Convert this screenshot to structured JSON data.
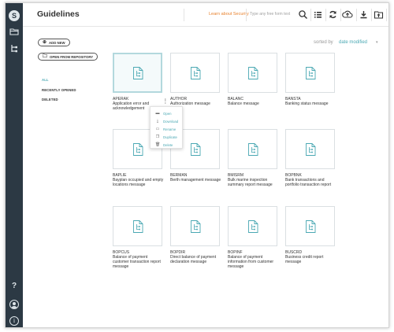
{
  "app": {
    "logo_letter": "S"
  },
  "header": {
    "title": "Guidelines",
    "learn_link": "Learn about Security",
    "search_placeholder": "Type any free form text"
  },
  "sidebar": {
    "add_new": "ADD NEW",
    "open_repo": "OPEN FROM REPOSITORY",
    "nav": [
      "ALL",
      "RECENTLY OPENED",
      "DELETED"
    ]
  },
  "rail": {
    "help": "?",
    "info": "i"
  },
  "sort": {
    "label": "sorted by",
    "value": "date modified"
  },
  "tiles": [
    {
      "name": "APERAK",
      "desc": "Application error and acknowledgement"
    },
    {
      "name": "AUTHOR",
      "desc": "Authorization message"
    },
    {
      "name": "BALANC",
      "desc": "Balance message"
    },
    {
      "name": "BANSTA",
      "desc": "Banking status message"
    },
    {
      "name": "BAPLIE",
      "desc": "Bayplan occupied and empty locations message"
    },
    {
      "name": "BERMAN",
      "desc": "Berth management message"
    },
    {
      "name": "BMISRM",
      "desc": "Bulk marine inspection summary report message"
    },
    {
      "name": "BOPBNK",
      "desc": "Bank transactions and portfolio transaction report"
    },
    {
      "name": "BOPCUS",
      "desc": "Balance of payment customer transaction report message"
    },
    {
      "name": "BOPDIR",
      "desc": "Direct balance of payment declaration message"
    },
    {
      "name": "BOPINF",
      "desc": "Balance of payment information from customer message"
    },
    {
      "name": "BUSCRD",
      "desc": "Business credit report message"
    }
  ],
  "context_menu": {
    "items": [
      {
        "label": "Open",
        "icon": "folder-icon"
      },
      {
        "label": "Download",
        "icon": "download-icon"
      },
      {
        "label": "Rename",
        "icon": "rename-icon"
      },
      {
        "label": "Duplicate",
        "icon": "duplicate-icon"
      },
      {
        "label": "Delete",
        "icon": "trash-icon"
      }
    ]
  },
  "colors": {
    "rail": "#2c3944",
    "accent": "#4aa8b3",
    "link": "#e8822e"
  }
}
